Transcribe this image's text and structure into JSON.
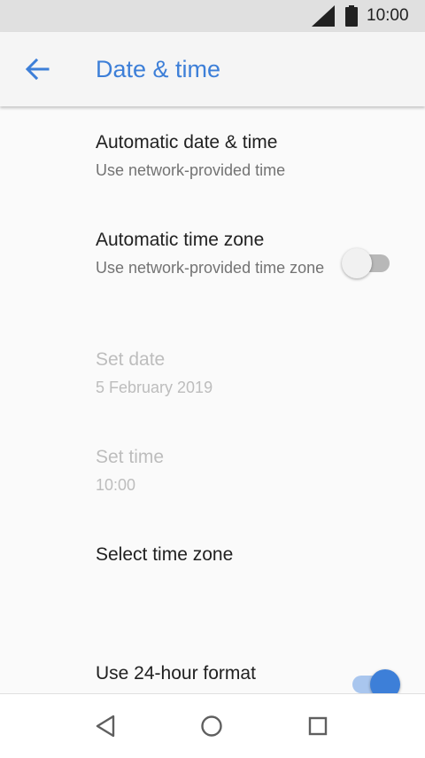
{
  "status_bar": {
    "time": "10:00",
    "icons": [
      "signal-icon",
      "battery-icon"
    ]
  },
  "app_bar": {
    "title": "Date & time",
    "back_icon": "back-arrow-icon",
    "accent_color": "#3d7fd8"
  },
  "preferences": [
    {
      "title": "Automatic date & time",
      "summary": "Use network-provided time",
      "enabled": true
    },
    {
      "title": "Automatic time zone",
      "summary": "Use network-provided time zone",
      "enabled": true,
      "switch": "off"
    },
    {
      "title": "Set date",
      "summary": "5 February 2019",
      "enabled": false
    },
    {
      "title": "Set time",
      "summary": "10:00",
      "enabled": false
    },
    {
      "title": "Select time zone",
      "summary": "",
      "enabled": true
    },
    {
      "title": "Use 24-hour format",
      "summary": "",
      "enabled": true,
      "switch": "on"
    }
  ],
  "nav_bar": {
    "buttons": [
      "back-triangle-icon",
      "home-circle-icon",
      "recents-square-icon"
    ]
  }
}
